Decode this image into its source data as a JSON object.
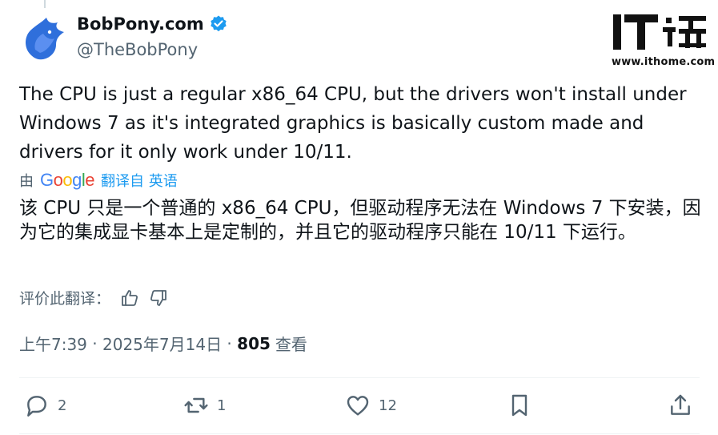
{
  "author": {
    "display_name": "BobPony.com",
    "handle": "@TheBobPony"
  },
  "watermark": {
    "site": "www.ithome.com"
  },
  "tweet": {
    "text": "The CPU is just a regular x86_64 CPU, but the drivers won't install under Windows 7 as it's integrated graphics is basically custom made and drivers for it only work under 10/11."
  },
  "translation": {
    "by_label": "由",
    "provider": "Google",
    "translated_from": "翻译自 英语",
    "text": "该 CPU 只是一个普通的 x86_64 CPU，但驱动程序无法在 Windows 7 下安装，因为它的集成显卡基本上是定制的，并且它的驱动程序只能在 10/11 下运行。",
    "rate_label": "评价此翻译："
  },
  "meta": {
    "time": "上午7:39",
    "date": "2025年7月14日",
    "separator": " · ",
    "views_count": "805",
    "views_label": "查看"
  },
  "actions": {
    "replies": "2",
    "reposts": "1",
    "likes": "12"
  },
  "colors": {
    "accent": "#1d9bf0",
    "verified": "#1d9bf0",
    "secondary_text": "#536471",
    "avatar_blue": "#2f6fdb"
  }
}
